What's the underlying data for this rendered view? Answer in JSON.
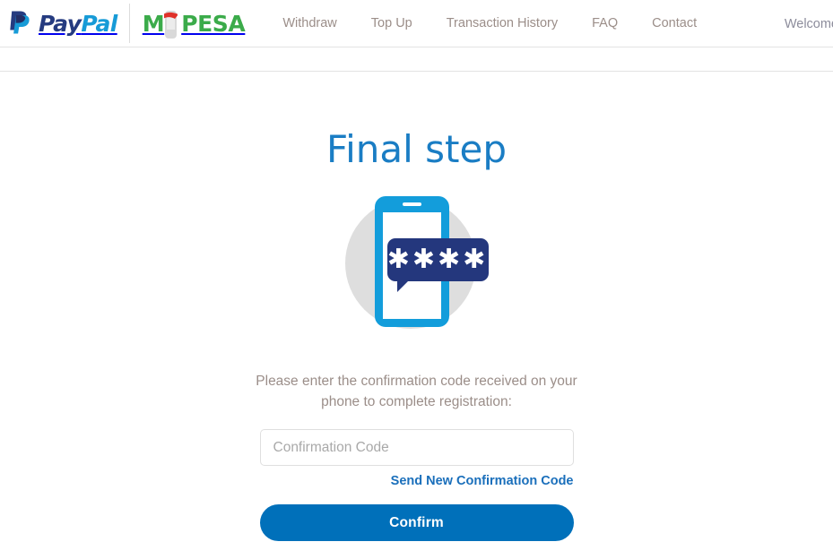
{
  "header": {
    "paypal_logo": {
      "mark": "paypal-monogram-icon",
      "word_part1": "Pay",
      "word_part2": "Pal"
    },
    "mpesa_logo": {
      "prefix": "M",
      "suffix": "PESA",
      "icon": "mpesa-phone-icon"
    },
    "nav_items": [
      {
        "id": "withdraw",
        "label": "Withdraw"
      },
      {
        "id": "top-up",
        "label": "Top Up"
      },
      {
        "id": "transaction-history",
        "label": "Transaction History"
      },
      {
        "id": "faq",
        "label": "FAQ"
      },
      {
        "id": "contact",
        "label": "Contact"
      }
    ],
    "welcome": "Welcome"
  },
  "main": {
    "title": "Final step",
    "illustration": {
      "name": "phone-sms-code-illustration",
      "bubble_text": "✱✱✱✱",
      "circle_color": "#dededd",
      "phone_color": "#139ddb",
      "bubble_color": "#24377d"
    },
    "instructions": "Please enter the confirmation code received on your phone to complete registration:",
    "code_input": {
      "placeholder": "Confirmation Code",
      "value": ""
    },
    "resend_link": "Send New Confirmation Code",
    "confirm_button": "Confirm"
  },
  "colors": {
    "accent_blue": "#0070ba",
    "title_blue": "#1a7dc4",
    "link_blue": "#1a6fbb",
    "nav_text": "#9b8e89",
    "paypal_navy": "#253b80",
    "paypal_light": "#179bd7",
    "mpesa_green": "#3bab4a",
    "mpesa_red": "#e0312a"
  }
}
